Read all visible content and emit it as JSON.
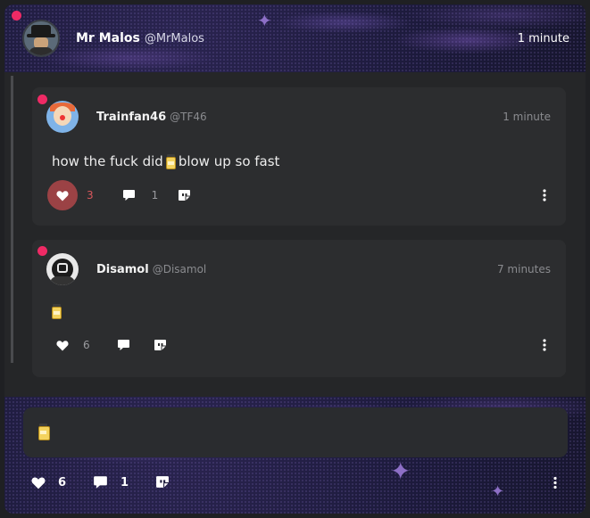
{
  "post": {
    "author_name": "Mr Malos",
    "author_handle": "@MrMalos",
    "time": "1 minute",
    "likes": "6",
    "comments": "1"
  },
  "replies": [
    {
      "author_name": "Trainfan46",
      "author_handle": "@TF46",
      "time": "1 minute",
      "text_before": "how the fuck did",
      "text_after": "blow up so fast",
      "likes": "3",
      "comments": "1",
      "liked": true
    },
    {
      "author_name": "Disamol",
      "author_handle": "@Disamol",
      "time": "7 minutes",
      "likes": "6",
      "liked": false
    }
  ],
  "colors": {
    "online_dot": "#ef2a65",
    "liked_bg": "#9b4245",
    "liked_count": "#d9575c",
    "card_bg": "#2c2d2f",
    "page_bg": "#252628"
  },
  "icons": [
    "heart-icon",
    "comment-icon",
    "quote-icon",
    "more-icon",
    "jar-emoji"
  ]
}
